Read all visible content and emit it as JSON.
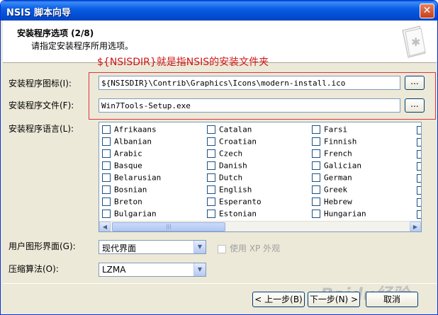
{
  "window": {
    "title": "NSIS 脚本向导",
    "close_icon": "close-icon"
  },
  "header": {
    "title": "安装程序选项 (2/8)",
    "subtitle": "请指定安装程序所用选项。",
    "icon": "installer-page-icon"
  },
  "annotation": "${NSISDIR}就是指NSIS的安装文件夹",
  "fields": {
    "icon_label": "安装程序图标(I):",
    "icon_value": "${NSISDIR}\\Contrib\\Graphics\\Icons\\modern-install.ico",
    "file_label": "安装程序文件(F):",
    "file_value": "Win7Tools-Setup.exe",
    "browse_label": "...",
    "language_label": "安装程序语言(L):",
    "ui_label": "用户图形界面(G):",
    "ui_value": "现代界面",
    "xp_label": "使用 XP 外观",
    "compress_label": "压缩算法(O):",
    "compress_value": "LZMA"
  },
  "languages": {
    "col1": [
      "Afrikaans",
      "Albanian",
      "Arabic",
      "Basque",
      "Belarusian",
      "Bosnian",
      "Breton",
      "Bulgarian"
    ],
    "col2": [
      "Catalan",
      "Croatian",
      "Czech",
      "Danish",
      "Dutch",
      "English",
      "Esperanto",
      "Estonian"
    ],
    "col3": [
      "Farsi",
      "Finnish",
      "French",
      "Galician",
      "German",
      "Greek",
      "Hebrew",
      "Hungarian"
    ]
  },
  "buttons": {
    "back": "< 上一步(B)",
    "next": "下一步(N) >",
    "cancel": "取消"
  },
  "watermark": "Baidu经验",
  "colors": {
    "annotation": "#d21414",
    "titlebar": "#0a5ee6"
  }
}
